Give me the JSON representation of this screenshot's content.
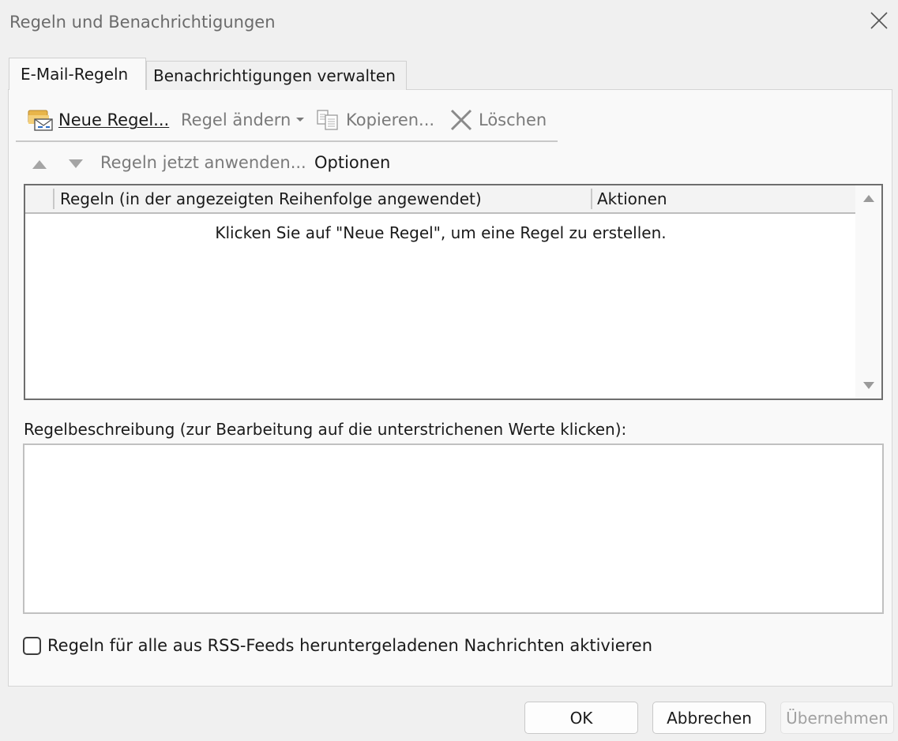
{
  "window": {
    "title": "Regeln und Benachrichtigungen",
    "close_icon": "close-icon"
  },
  "tabs": [
    {
      "label": "E-Mail-Regeln",
      "active": true
    },
    {
      "label": "Benachrichtigungen verwalten",
      "active": false
    }
  ],
  "toolbar": {
    "new_rule": {
      "label": "Neue Regel...",
      "icon": "new-rule-icon",
      "enabled": true
    },
    "change_rule": {
      "label": "Regel ändern",
      "icon": "chevron-down-icon",
      "enabled": false
    },
    "copy": {
      "label": "Kopieren...",
      "icon": "copy-icon",
      "enabled": false
    },
    "delete": {
      "label": "Löschen",
      "icon": "delete-x-icon",
      "enabled": false
    }
  },
  "secondary_toolbar": {
    "move_up_icon": "triangle-up-icon",
    "move_down_icon": "triangle-down-icon",
    "apply_now": "Regeln jetzt anwenden...",
    "options": "Optionen"
  },
  "rules_list": {
    "columns": [
      "Regeln (in der angezeigten Reihenfolge angewendet)",
      "Aktionen"
    ],
    "rows": [],
    "empty_message": "Klicken Sie auf \"Neue Regel\", um eine Regel zu erstellen."
  },
  "description": {
    "label": "Regelbeschreibung (zur Bearbeitung auf die unterstrichenen Werte klicken):",
    "value": ""
  },
  "rss_checkbox": {
    "label": "Regeln für alle aus RSS-Feeds heruntergeladenen Nachrichten aktivieren",
    "checked": false
  },
  "buttons": {
    "ok": "OK",
    "cancel": "Abbrechen",
    "apply": "Übernehmen"
  },
  "colors": {
    "background": "#f0f0f0",
    "panel": "#f9f9f9",
    "disabled_text": "#7a7a7a"
  }
}
